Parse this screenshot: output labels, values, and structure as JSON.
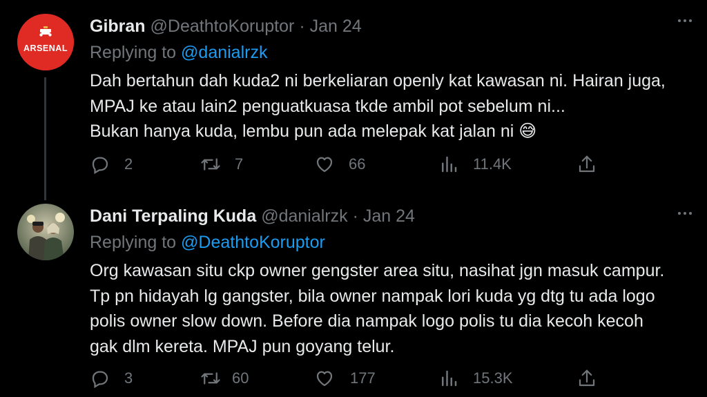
{
  "tweets": [
    {
      "name": "Gibran",
      "handle": "@DeathtoKoruptor",
      "separator": "·",
      "date": "Jan 24",
      "replying_prefix": "Replying to ",
      "replying_to": "@danialrzk",
      "avatar_text": "ARSENAL",
      "lines": [
        "Dah bertahun dah kuda2 ni berkeliaran openly kat kawasan ni. Hairan juga,",
        "MPAJ ke atau lain2 penguatkuasa tkde ambil pot sebelum ni...",
        "Bukan hanya kuda, lembu pun ada melepak kat jalan ni"
      ],
      "emoji": "😅",
      "replies": "2",
      "retweets": "7",
      "likes": "66",
      "views": "11.4K"
    },
    {
      "name": "Dani Terpaling Kuda",
      "handle": "@danialrzk",
      "separator": "·",
      "date": "Jan 24",
      "replying_prefix": "Replying to ",
      "replying_to": "@DeathtoKoruptor",
      "lines": [
        "Org kawasan situ ckp owner gengster area situ, nasihat jgn masuk campur.",
        "Tp pn hidayah lg gangster, bila owner nampak lori kuda yg dtg tu ada logo",
        "polis owner slow down. Before dia nampak logo polis tu dia kecoh kecoh",
        "gak dlm kereta. MPAJ pun goyang telur."
      ],
      "replies": "3",
      "retweets": "60",
      "likes": "177",
      "views": "15.3K"
    }
  ],
  "icons": [
    "reply-icon",
    "retweet-icon",
    "like-icon",
    "views-icon",
    "share-icon",
    "more-icon"
  ],
  "colors": {
    "background": "#000000",
    "text": "#e7e9ea",
    "muted": "#71767b",
    "link": "#1d9bf0",
    "arsenal_red": "#e02b25",
    "thread_line": "#333639"
  }
}
